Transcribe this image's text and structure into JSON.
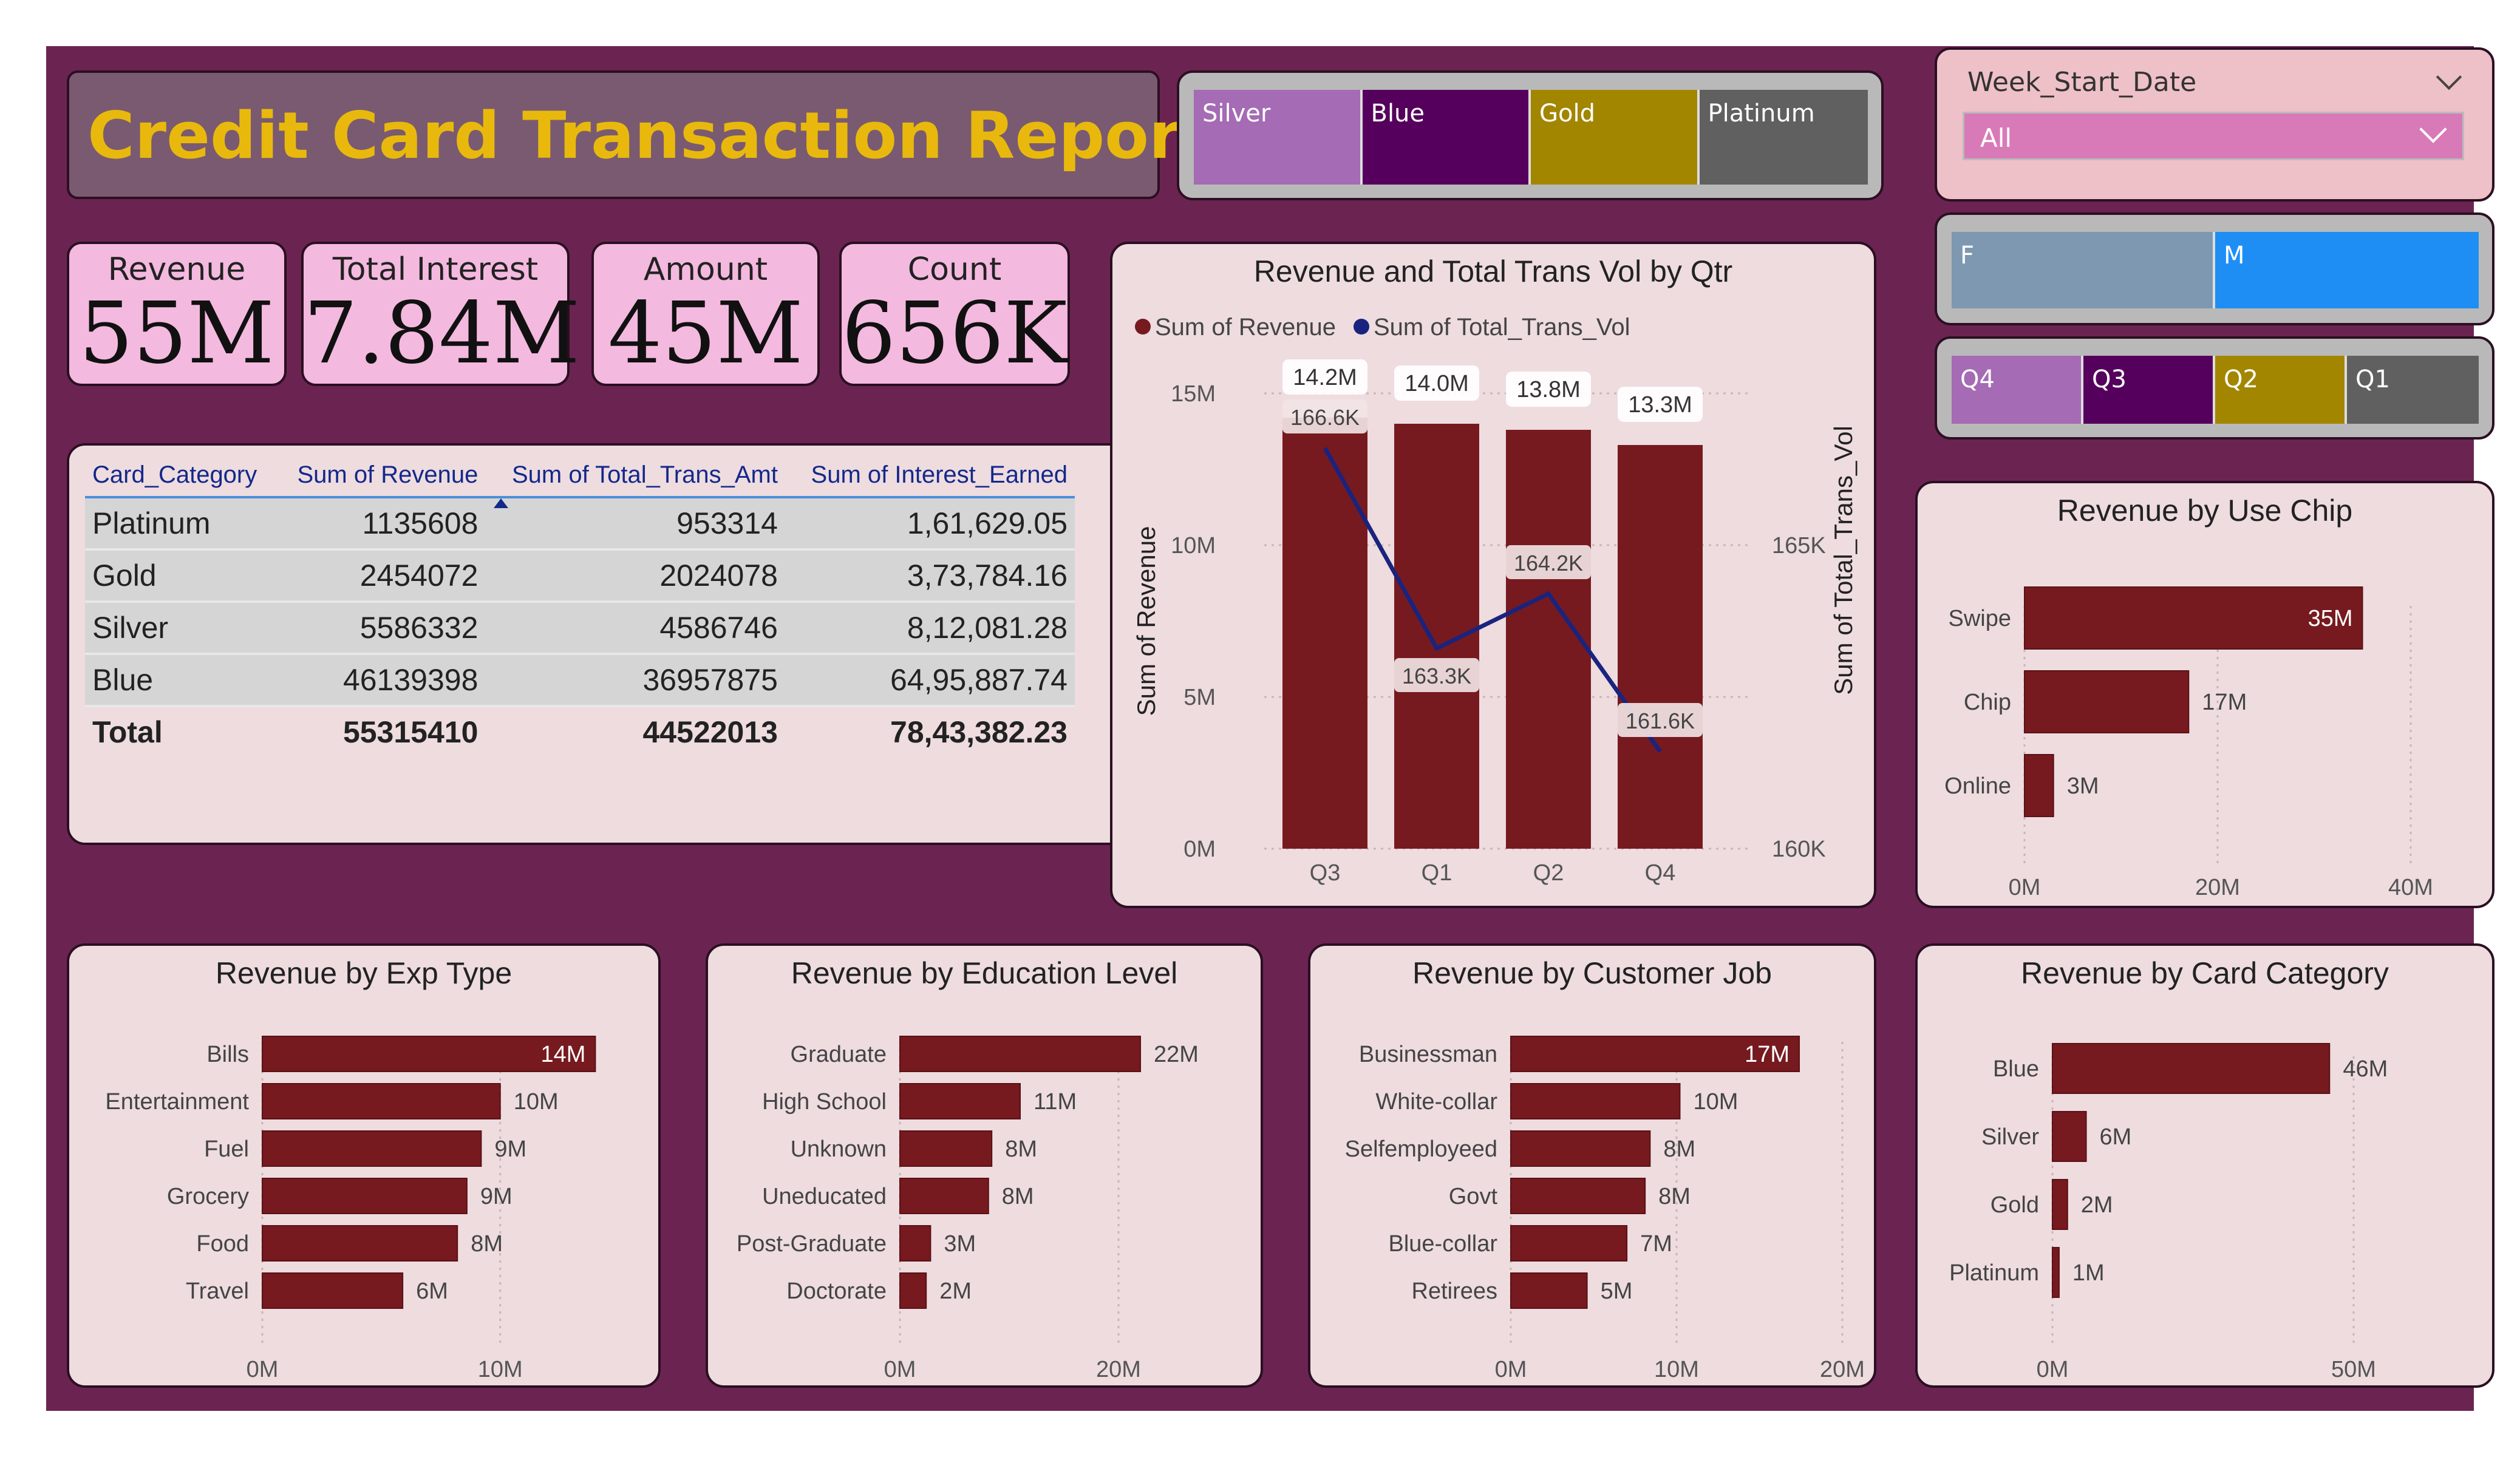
{
  "header": {
    "title": "Credit Card Transaction Report"
  },
  "kpis": [
    {
      "label": "Revenue",
      "value": "55M"
    },
    {
      "label": "Total Interest",
      "value": "7.84M"
    },
    {
      "label": "Amount",
      "value": "45M"
    },
    {
      "label": "Count",
      "value": "656K"
    }
  ],
  "card_slicer": {
    "items": [
      {
        "label": "Silver",
        "color": "#a56bb4"
      },
      {
        "label": "Blue",
        "color": "#55005c"
      },
      {
        "label": "Gold",
        "color": "#a38600"
      },
      {
        "label": "Platinum",
        "color": "#606060"
      }
    ]
  },
  "week_filter": {
    "title": "Week_Start_Date",
    "selected": "All"
  },
  "gender_slicer": {
    "items": [
      {
        "label": "F",
        "color": "#7f98b1"
      },
      {
        "label": "M",
        "color": "#1e8ef5"
      }
    ]
  },
  "qtr_slicer": {
    "items": [
      {
        "label": "Q4",
        "color": "#a56bb4"
      },
      {
        "label": "Q3",
        "color": "#55005c"
      },
      {
        "label": "Q2",
        "color": "#a38600"
      },
      {
        "label": "Q1",
        "color": "#606060"
      }
    ]
  },
  "matrix": {
    "columns": [
      "Card_Category",
      "Sum of Revenue",
      "Sum of Total_Trans_Amt",
      "Sum of Interest_Earned"
    ],
    "rows": [
      [
        "Platinum",
        "1135608",
        "953314",
        "1,61,629.05"
      ],
      [
        "Gold",
        "2454072",
        "2024078",
        "3,73,784.16"
      ],
      [
        "Silver",
        "5586332",
        "4586746",
        "8,12,081.28"
      ],
      [
        "Blue",
        "46139398",
        "36957875",
        "64,95,887.74"
      ]
    ],
    "total": [
      "Total",
      "55315410",
      "44522013",
      "78,43,382.23"
    ]
  },
  "chart_data": [
    {
      "type": "combo",
      "title": "Revenue and Total Trans Vol by Qtr",
      "legend": [
        "Sum of Revenue",
        "Sum of Total_Trans_Vol"
      ],
      "ylabel": "Sum of Revenue",
      "y2label": "Sum of Total_Trans_Vol",
      "categories": [
        "Q3",
        "Q1",
        "Q2",
        "Q4"
      ],
      "bar_values": [
        14.2,
        14.0,
        13.8,
        13.3
      ],
      "bar_labels": [
        "14.2M",
        "14.0M",
        "13.8M",
        "13.3M"
      ],
      "line_values": [
        166.6,
        163.3,
        164.2,
        161.6
      ],
      "line_labels": [
        "166.6K",
        "163.3K",
        "164.2K",
        "161.6K"
      ],
      "ylim": [
        0,
        15
      ],
      "yticks": [
        "0M",
        "5M",
        "10M",
        "15M"
      ],
      "y2lim": [
        160,
        167.5
      ],
      "y2ticks": [
        "160K",
        "165K"
      ],
      "colors": {
        "bar": "#761a1f",
        "line": "#1a237e"
      }
    },
    {
      "type": "bar",
      "title": "Revenue by Use Chip",
      "categories": [
        "Swipe",
        "Chip",
        "Online"
      ],
      "values": [
        35,
        17,
        3
      ],
      "labels": [
        "35M",
        "17M",
        "3M"
      ],
      "xlim": [
        0,
        40
      ],
      "xticks": [
        "0M",
        "20M",
        "40M"
      ]
    },
    {
      "type": "bar",
      "title": "Revenue by Exp Type",
      "categories": [
        "Bills",
        "Entertainment",
        "Fuel",
        "Grocery",
        "Food",
        "Travel"
      ],
      "values": [
        14,
        10,
        9.2,
        8.6,
        8.2,
        5.9
      ],
      "labels": [
        "14M",
        "10M",
        "9M",
        "9M",
        "8M",
        "6M"
      ],
      "xlim": [
        0,
        14.5
      ],
      "xticks": [
        "0M",
        "10M"
      ]
    },
    {
      "type": "bar",
      "title": "Revenue by Education Level",
      "categories": [
        "Graduate",
        "High School",
        "Unknown",
        "Uneducated",
        "Post-Graduate",
        "Doctorate"
      ],
      "values": [
        22,
        11,
        8.4,
        8.1,
        2.8,
        2.4
      ],
      "labels": [
        "22M",
        "11M",
        "8M",
        "8M",
        "3M",
        "2M"
      ],
      "xlim": [
        0,
        30
      ],
      "xticks": [
        "0M",
        "20M"
      ]
    },
    {
      "type": "bar",
      "title": "Revenue by Customer Job",
      "categories": [
        "Businessman",
        "White-collar",
        "Selfemployeed",
        "Govt",
        "Blue-collar",
        "Retirees"
      ],
      "values": [
        17.4,
        10.2,
        8.4,
        8.1,
        7.0,
        4.6
      ],
      "labels": [
        "17M",
        "10M",
        "8M",
        "8M",
        "7M",
        "5M"
      ],
      "xlim": [
        0,
        20
      ],
      "xticks": [
        "0M",
        "10M",
        "20M"
      ]
    },
    {
      "type": "bar",
      "title": "Revenue by Card Category",
      "categories": [
        "Blue",
        "Silver",
        "Gold",
        "Platinum"
      ],
      "values": [
        46,
        5.6,
        2.5,
        1.1
      ],
      "labels": [
        "46M",
        "6M",
        "2M",
        "1M"
      ],
      "xlim": [
        0,
        50
      ],
      "xticks": [
        "0M",
        "50M"
      ]
    }
  ]
}
